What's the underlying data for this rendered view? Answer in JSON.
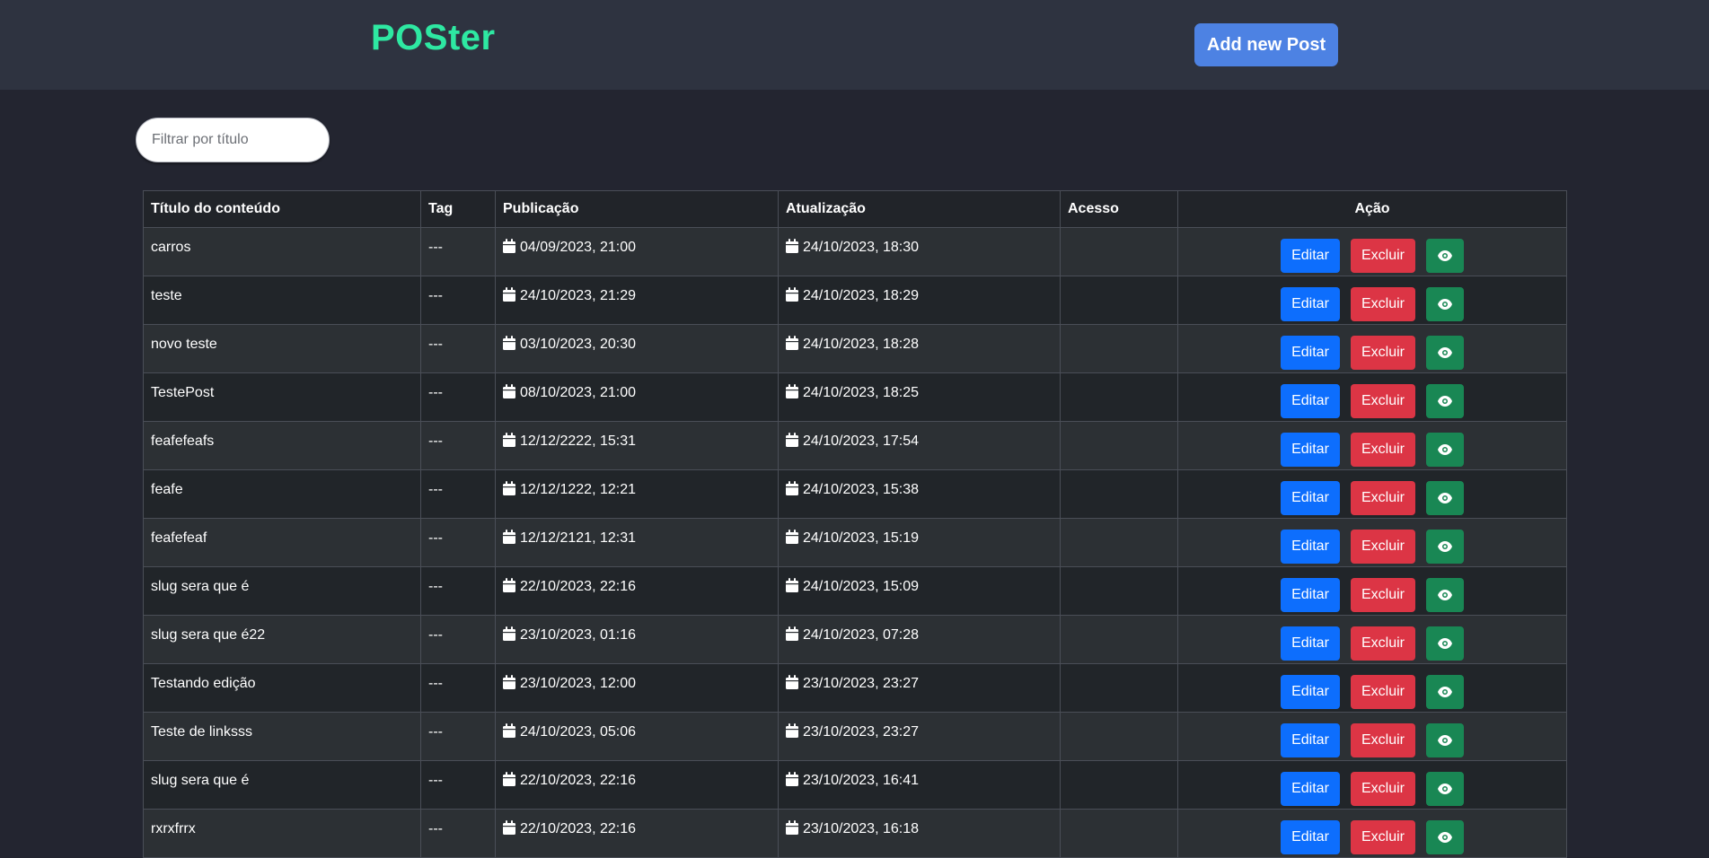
{
  "header": {
    "brand": "POSter",
    "add_button_label": "Add new Post"
  },
  "filter": {
    "placeholder": "Filtrar por título",
    "value": ""
  },
  "colors": {
    "brand": "#2ee8a2",
    "primary": "#0d6efd",
    "danger": "#dc3545",
    "success": "#198754",
    "add_button": "#4d82e3"
  },
  "table": {
    "columns": [
      "Título do conteúdo",
      "Tag",
      "Publicação",
      "Atualização",
      "Acesso",
      "Ação"
    ],
    "action_labels": {
      "edit": "Editar",
      "delete": "Excluir",
      "view_icon": "eye-icon"
    },
    "rows": [
      {
        "title": "carros",
        "tag": "---",
        "published": "04/09/2023, 21:00",
        "updated": "24/10/2023, 18:30",
        "access": ""
      },
      {
        "title": "teste",
        "tag": "---",
        "published": "24/10/2023, 21:29",
        "updated": "24/10/2023, 18:29",
        "access": ""
      },
      {
        "title": "novo teste",
        "tag": "---",
        "published": "03/10/2023, 20:30",
        "updated": "24/10/2023, 18:28",
        "access": ""
      },
      {
        "title": "TestePost",
        "tag": "---",
        "published": "08/10/2023, 21:00",
        "updated": "24/10/2023, 18:25",
        "access": ""
      },
      {
        "title": "feafefeafs",
        "tag": "---",
        "published": "12/12/2222, 15:31",
        "updated": "24/10/2023, 17:54",
        "access": ""
      },
      {
        "title": "feafe",
        "tag": "---",
        "published": "12/12/1222, 12:21",
        "updated": "24/10/2023, 15:38",
        "access": ""
      },
      {
        "title": "feafefeaf",
        "tag": "---",
        "published": "12/12/2121, 12:31",
        "updated": "24/10/2023, 15:19",
        "access": ""
      },
      {
        "title": "slug sera que é",
        "tag": "---",
        "published": "22/10/2023, 22:16",
        "updated": "24/10/2023, 15:09",
        "access": ""
      },
      {
        "title": "slug sera que é22",
        "tag": "---",
        "published": "23/10/2023, 01:16",
        "updated": "24/10/2023, 07:28",
        "access": ""
      },
      {
        "title": "Testando edição",
        "tag": "---",
        "published": "23/10/2023, 12:00",
        "updated": "23/10/2023, 23:27",
        "access": ""
      },
      {
        "title": "Teste de linksss",
        "tag": "---",
        "published": "24/10/2023, 05:06",
        "updated": "23/10/2023, 23:27",
        "access": ""
      },
      {
        "title": "slug sera que é",
        "tag": "---",
        "published": "22/10/2023, 22:16",
        "updated": "23/10/2023, 16:41",
        "access": ""
      },
      {
        "title": "rxrxfrrx",
        "tag": "---",
        "published": "22/10/2023, 22:16",
        "updated": "23/10/2023, 16:18",
        "access": ""
      }
    ]
  }
}
